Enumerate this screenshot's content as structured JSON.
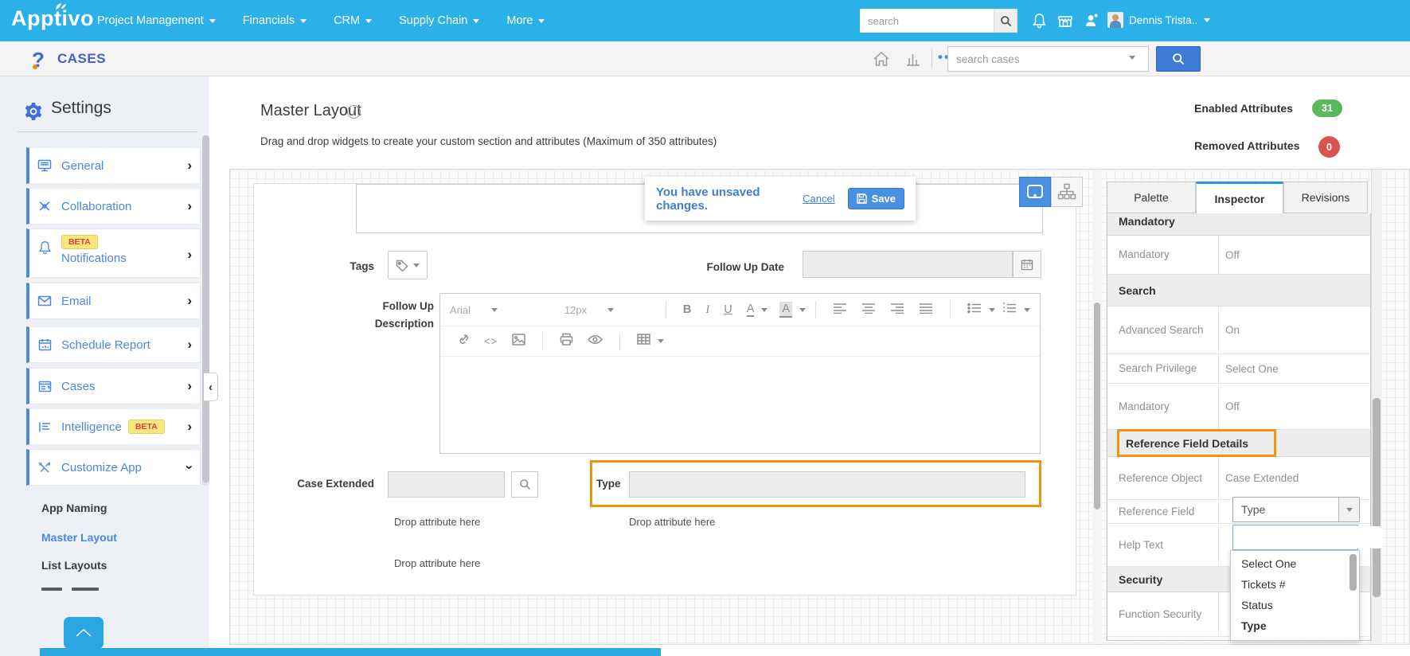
{
  "topbar": {
    "brand": "Apptivo",
    "nav": [
      {
        "label": "Project Management"
      },
      {
        "label": "Financials"
      },
      {
        "label": "CRM"
      },
      {
        "label": "Supply Chain"
      },
      {
        "label": "More"
      }
    ],
    "search_placeholder": "search",
    "user_name": "Dennis Trista.."
  },
  "appbar": {
    "app_title": "CASES",
    "overflow_dots": "•••",
    "search_placeholder": "search cases"
  },
  "sidebar": {
    "title": "Settings",
    "items": [
      {
        "label": "General"
      },
      {
        "label": "Collaboration"
      },
      {
        "label": "Notifications",
        "beta": "BETA"
      },
      {
        "label": "Email"
      },
      {
        "label": "Schedule Report"
      },
      {
        "label": "Cases"
      },
      {
        "label": "Intelligence",
        "beta": "BETA"
      },
      {
        "label": "Customize App"
      }
    ],
    "sub_items": [
      {
        "label": "App Naming"
      },
      {
        "label": "Master Layout"
      },
      {
        "label": "List Layouts"
      }
    ],
    "active_sub": "Master Layout"
  },
  "main": {
    "title": "Master Layout",
    "info": "i",
    "subtitle": "Drag and drop widgets to create your custom section and attributes (Maximum of 350 attributes)",
    "counters": [
      {
        "label": "Enabled Attributes",
        "value": "31"
      },
      {
        "label": "Removed Attributes",
        "value": "0"
      }
    ],
    "toast": {
      "message": "You have unsaved changes.",
      "cancel_label": "Cancel",
      "save_label": "Save"
    }
  },
  "form": {
    "tags_label": "Tags",
    "follow_up_date_label": "Follow Up Date",
    "follow_up_desc_label_line1": "Follow Up",
    "follow_up_desc_label_line2": "Description",
    "case_extended_label": "Case Extended",
    "type_label": "Type",
    "drop_hint": "Drop attribute here",
    "editor": {
      "font_name": "Arial",
      "font_size": "12px",
      "bold": "B",
      "italic": "I",
      "underline": "U",
      "text_color": "A",
      "bg_color": "A",
      "code": "<>"
    }
  },
  "inspector": {
    "tabs": [
      {
        "label": "Palette"
      },
      {
        "label": "Inspector"
      },
      {
        "label": "Revisions"
      }
    ],
    "active_tab": "Inspector",
    "rows": [
      {
        "type": "section",
        "label": "Mandatory"
      },
      {
        "type": "row",
        "label": "Mandatory",
        "value": "Off"
      },
      {
        "type": "section",
        "label": "Search"
      },
      {
        "type": "row",
        "label": "Advanced Search",
        "value": "On"
      },
      {
        "type": "row",
        "label": "Search Privilege",
        "value": "Select One"
      },
      {
        "type": "row",
        "label": "Mandatory",
        "value": "Off"
      },
      {
        "type": "section",
        "label": "Reference Field Details"
      },
      {
        "type": "row",
        "label": "Reference Object",
        "value": "Case Extended"
      },
      {
        "type": "row",
        "label": "Reference Field",
        "value": "Type"
      },
      {
        "type": "row",
        "label": "Help Text",
        "value": ""
      },
      {
        "type": "section",
        "label": "Security"
      },
      {
        "type": "row",
        "label": "Function Security",
        "value": ""
      }
    ],
    "dropdown": {
      "value": "Type",
      "search_value": "",
      "options": [
        {
          "label": "Select One"
        },
        {
          "label": "Tickets #"
        },
        {
          "label": "Status"
        },
        {
          "label": "Type"
        }
      ],
      "selected_option": "Type"
    }
  },
  "colors": {
    "topbar_blue": "#2bb0e8",
    "link_blue": "#4a89dc",
    "accent_blue": "#4a90e2",
    "enabled_green": "#5cb85c",
    "removed_red": "#d9534f",
    "highlight_orange": "#f2930d"
  }
}
